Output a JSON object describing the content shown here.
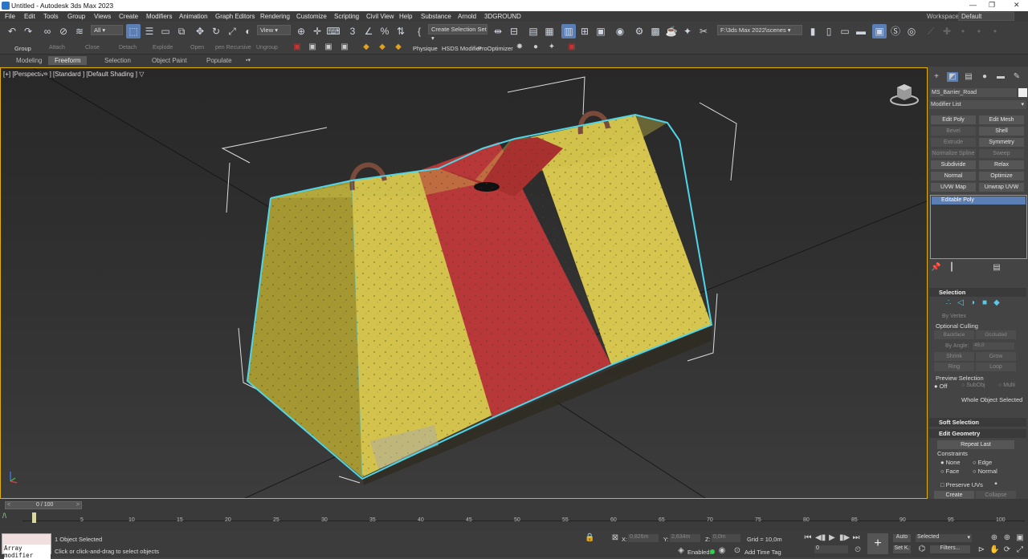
{
  "window": {
    "title": "Untitled - Autodesk 3ds Max 2023",
    "workspace_label": "Workspaces:",
    "workspace_value": "Default"
  },
  "menu": [
    "File",
    "Edit",
    "Tools",
    "Group",
    "Views",
    "Create",
    "Modifiers",
    "Animation",
    "Graph Editors",
    "Rendering",
    "Customize",
    "Scripting",
    "Civil View",
    "Help",
    "Substance",
    "Arnold",
    "3DGROUND"
  ],
  "toolbar": {
    "filter": "All",
    "ref_coord": "View",
    "selection_set": "Create Selection Set",
    "path": "F:\\3ds Max 2022\\scenes",
    "sub_labels": {
      "group": "Group",
      "attach": "Attach",
      "close": "Close",
      "detach": "Detach",
      "explode": "Explode",
      "open": "Open",
      "open_recursive": "pen Recursive",
      "ungroup": "Ungroup"
    },
    "plugins": {
      "physique": "Physique",
      "hsds": "HSDS Modifier",
      "proopt": "ProOptimizer"
    }
  },
  "ribbon_tabs": [
    "Modeling",
    "Freeform",
    "Selection",
    "Object Paint",
    "Populate"
  ],
  "viewport": {
    "label": "[+] [Perspective ] [Standard ] [Default Shading ]"
  },
  "command_panel": {
    "object_name": "MS_Barrier_Road",
    "modifier_list": "Modifier List",
    "buttons": [
      {
        "label": "Edit Poly",
        "enabled": true
      },
      {
        "label": "Edit Mesh",
        "enabled": true
      },
      {
        "label": "Bevel",
        "enabled": false
      },
      {
        "label": "Shell",
        "enabled": true
      },
      {
        "label": "Extrude",
        "enabled": false
      },
      {
        "label": "Symmetry",
        "enabled": true
      },
      {
        "label": "Normalize Spline",
        "enabled": false
      },
      {
        "label": "Sweep",
        "enabled": false
      },
      {
        "label": "Subdivide",
        "enabled": true
      },
      {
        "label": "Relax",
        "enabled": true
      },
      {
        "label": "Normal",
        "enabled": true
      },
      {
        "label": "Optimize",
        "enabled": true
      },
      {
        "label": "UVW Map",
        "enabled": true
      },
      {
        "label": "Unwrap UVW",
        "enabled": true
      }
    ],
    "stack_item": "Editable Poly",
    "selection": {
      "title": "Selection",
      "by_vertex": "By Vertex",
      "optional_culling": "Optional Culling",
      "backface": "Backface",
      "occluded": "Occluded",
      "by_angle": "By Angle:",
      "angle_value": "45,0",
      "shrink": "Shrink",
      "grow": "Grow",
      "ring": "Ring",
      "loop": "Loop",
      "preview_selection": "Preview Selection",
      "off": "Off",
      "subobj": "SubObj",
      "multi": "Multi",
      "whole_object": "Whole Object Selected"
    },
    "soft_selection": "Soft Selection",
    "edit_geometry": {
      "title": "Edit Geometry",
      "repeat_last": "Repeat Last",
      "constraints": "Constraints",
      "none": "None",
      "edge": "Edge",
      "face": "Face",
      "normal": "Normal",
      "preserve_uvs": "Preserve UVs",
      "create": "Create",
      "collapse": "Collapse"
    }
  },
  "timeline": {
    "frame_display": "0 / 100",
    "ticks": [
      "5",
      "10",
      "15",
      "20",
      "25",
      "30",
      "35",
      "40",
      "45",
      "50",
      "55",
      "60",
      "65",
      "70",
      "75",
      "80",
      "85",
      "90",
      "95",
      "100"
    ]
  },
  "status": {
    "maxscript": "Array modifier",
    "objects_selected": "1 Object Selected",
    "prompt": "Click or click-and-drag to select objects",
    "x_label": "X:",
    "x_value": "0,826m",
    "y_label": "Y:",
    "y_value": "2,634m",
    "z_label": "Z:",
    "z_value": "0,0m",
    "grid": "Grid = 10,0m",
    "enabled": "Enabled:",
    "add_time_tag": "Add Time Tag",
    "auto": "Auto",
    "selected": "Selected",
    "set_key": "Set K.",
    "filters": "Filters...",
    "current_frame": "0"
  },
  "colors": {
    "accent": "#5b7fb4",
    "viewport_border": "#e2b000",
    "selection_outline": "#4fd6e8",
    "barrier_yellow": "#d6c24a",
    "barrier_red": "#b8383a"
  }
}
